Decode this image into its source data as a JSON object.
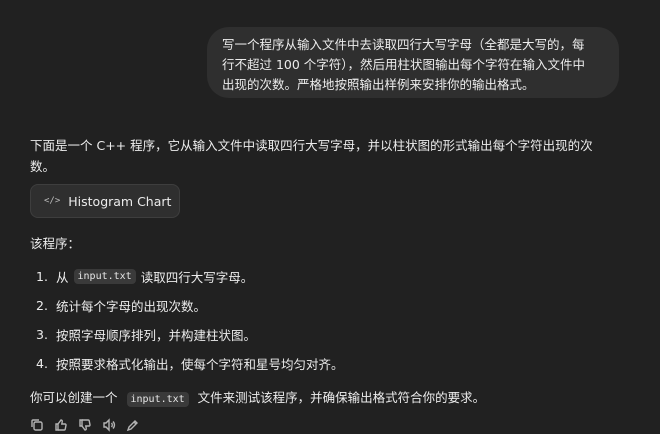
{
  "user_message": {
    "line1": "写一个程序从输入文件中去读取四行大写字母（全都是大写的，每",
    "line2": "行不超过 100 个字符），然后用柱状图输出每个字符在输入文件中",
    "line3": "出现的次数。严格地按照输出样例来安排你的输出格式。"
  },
  "assistant": {
    "intro_line1": "下面是一个 C++ 程序，它从输入文件中读取四行大写字母，并以柱状图的形式输出每个字符出现的次",
    "intro_line2": "数。",
    "artifact": {
      "icon_text": "</>",
      "label": "Histogram Chart"
    },
    "program_label": "该程序：",
    "steps": [
      {
        "num": "1.",
        "pre": "从",
        "code": "input.txt",
        "post": "读取四行大写字母。"
      },
      {
        "num": "2.",
        "text": "统计每个字母的出现次数。"
      },
      {
        "num": "3.",
        "text": "按照字母顺序排列，并构建柱状图。"
      },
      {
        "num": "4.",
        "text": "按照要求格式化输出，使每个字符和星号均匀对齐。"
      }
    ],
    "outro": {
      "pre": "你可以创建一个",
      "code": "input.txt",
      "post": "文件来测试该程序，并确保输出格式符合你的要求。"
    }
  },
  "actions": [
    "copy-icon",
    "thumbs-up-icon",
    "thumbs-down-icon",
    "speaker-icon",
    "edit-icon"
  ]
}
